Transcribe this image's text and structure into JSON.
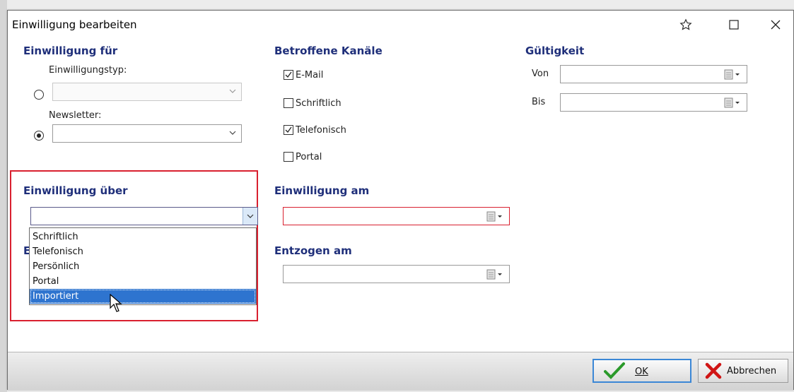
{
  "window": {
    "title": "Einwilligung bearbeiten"
  },
  "sections": {
    "einwilligung_fuer": {
      "title": "Einwilligung für",
      "typ_label": "Einwilligungstyp:",
      "newsletter_label": "Newsletter:"
    },
    "betroffene_kanaele": {
      "title": "Betroffene Kanäle",
      "channels": [
        {
          "label": "E-Mail",
          "checked": true
        },
        {
          "label": "Schriftlich",
          "checked": false
        },
        {
          "label": "Telefonisch",
          "checked": true
        },
        {
          "label": "Portal",
          "checked": false
        }
      ]
    },
    "gueltigkeit": {
      "title": "Gültigkeit",
      "von_label": "Von",
      "bis_label": "Bis"
    },
    "einwilligung_ueber": {
      "title": "Einwilligung über",
      "options": [
        "Schriftlich",
        "Telefonisch",
        "Persönlich",
        "Portal",
        "Importiert"
      ],
      "highlighted": "Importiert",
      "hidden_label_fragment": "E"
    },
    "einwilligung_am": {
      "title": "Einwilligung am"
    },
    "entzogen_am": {
      "title": "Entzogen am"
    }
  },
  "footer": {
    "ok_label": "OK",
    "cancel_label": "Abbrechen"
  },
  "colors": {
    "section_title": "#1f2f7a",
    "highlight_box": "#d9202f",
    "selection": "#2e74cf"
  }
}
